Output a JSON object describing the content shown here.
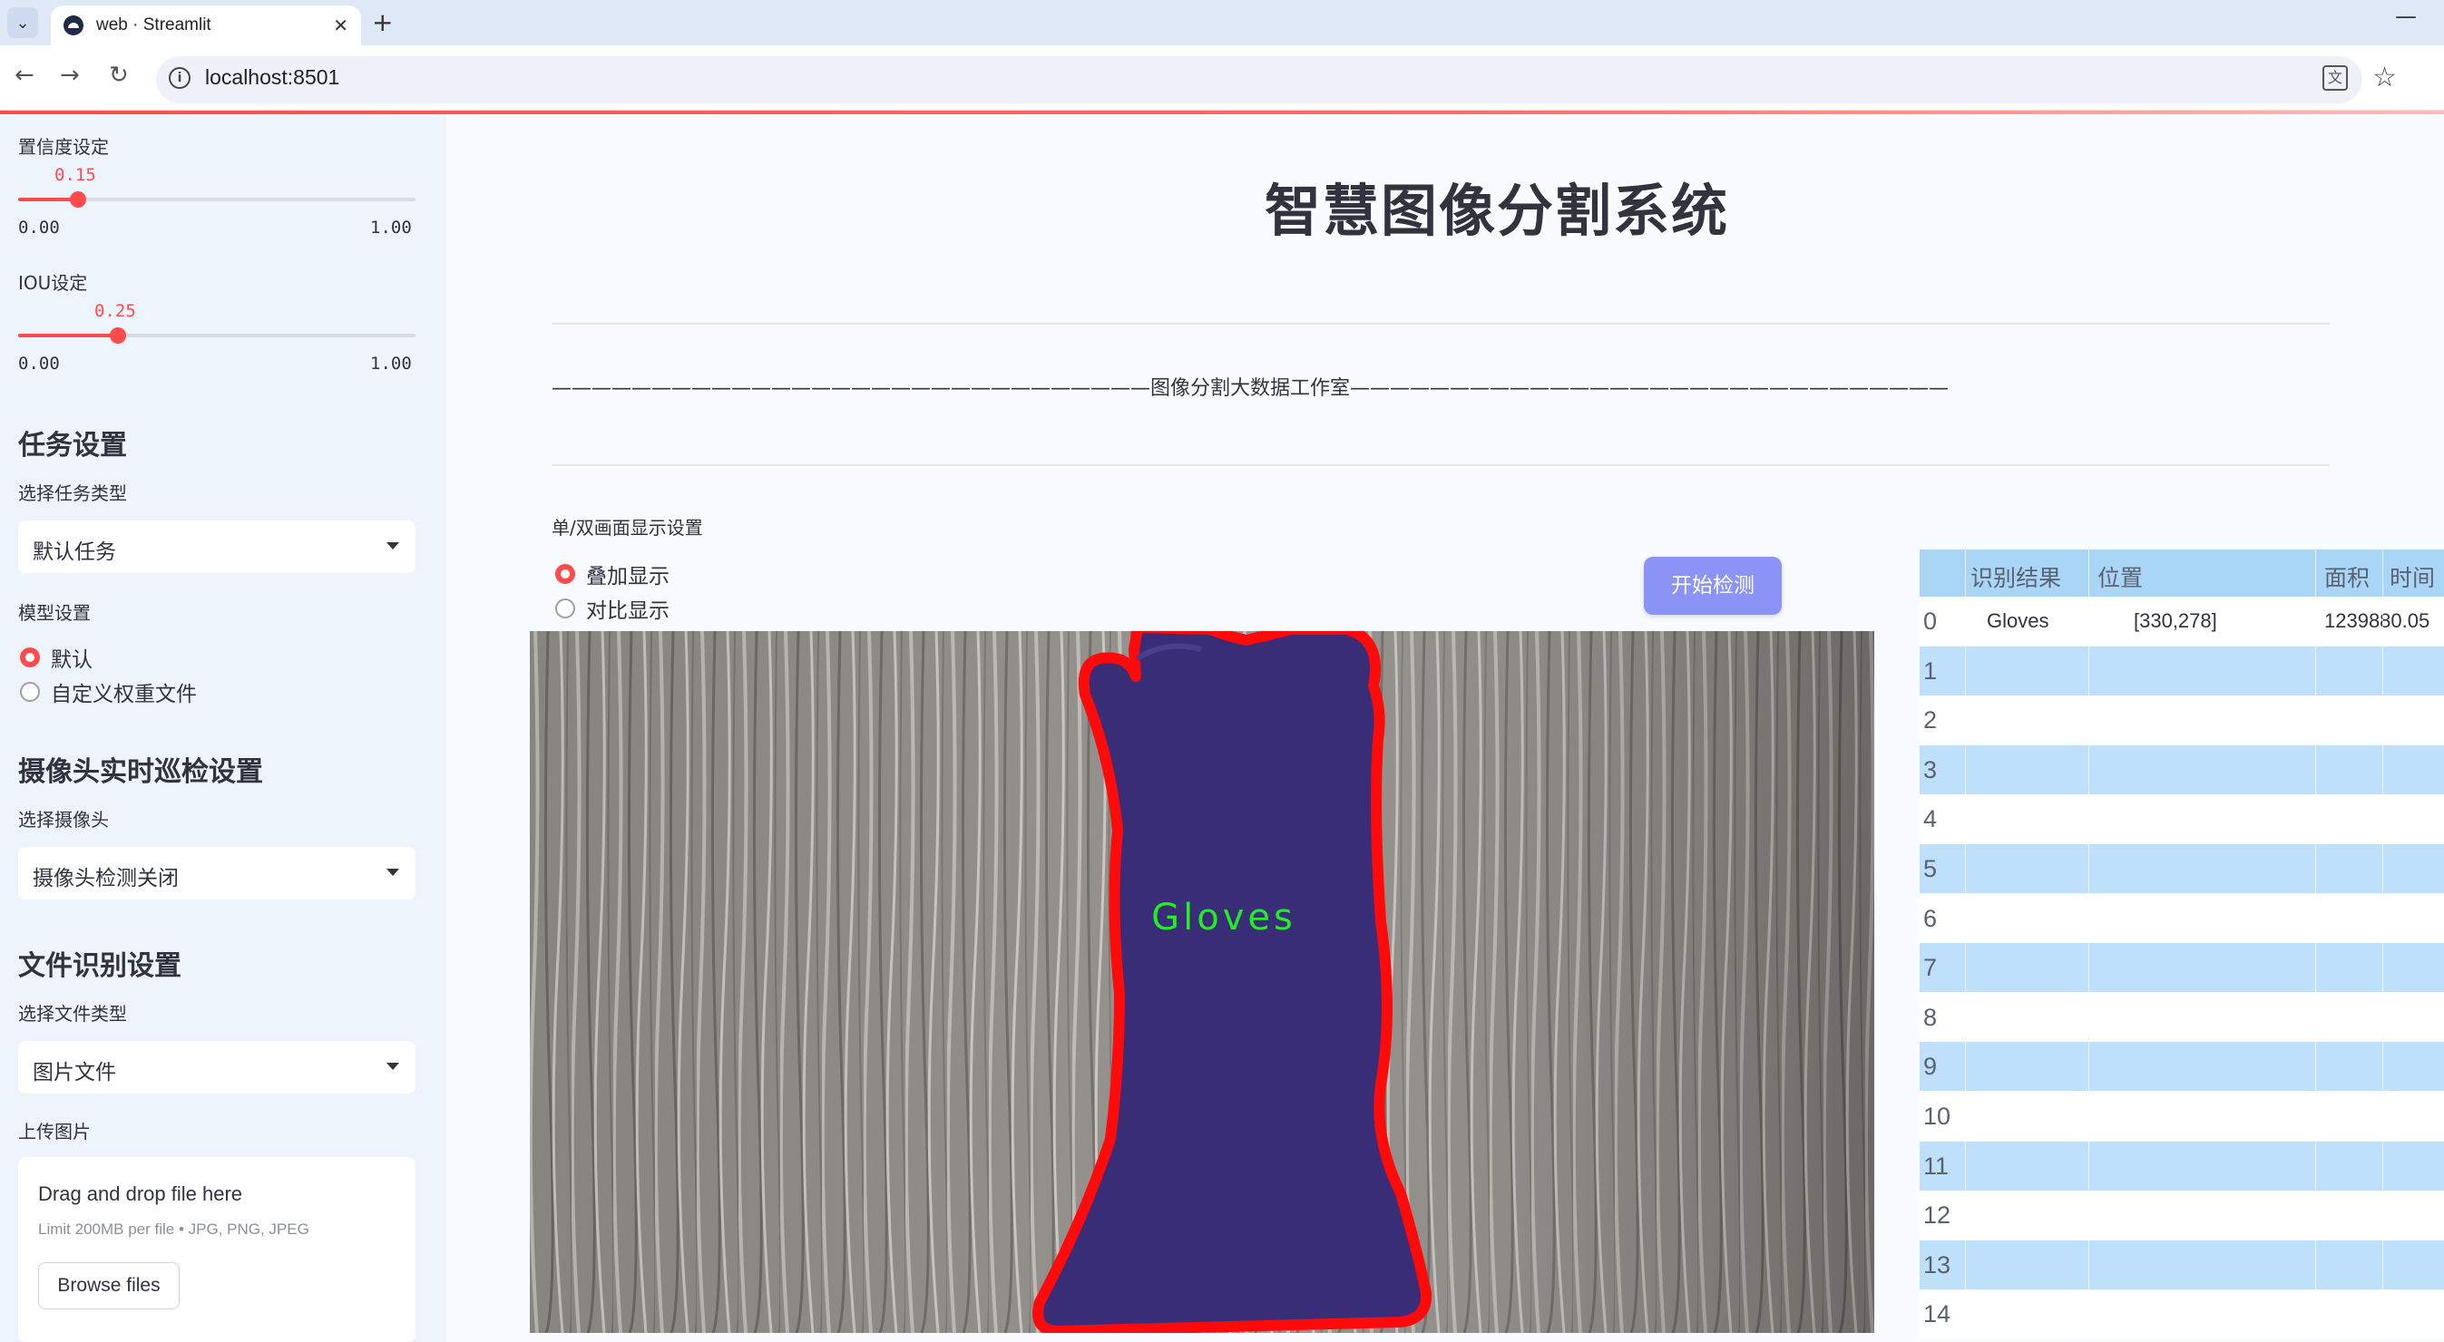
{
  "browser": {
    "tab_title": "web · Streamlit",
    "tab_close": "✕",
    "new_tab": "+",
    "minimize": "—",
    "url": "localhost:8501",
    "back": "←",
    "forward": "→",
    "reload": "↻",
    "dropdown": "⌄",
    "info": "i",
    "translate": "文",
    "bookmark": "☆"
  },
  "sidebar": {
    "confidence_label": "置信度设定",
    "confidence": {
      "value": 0.15,
      "value_text": "0.15",
      "min": "0.00",
      "max": "1.00"
    },
    "iou_label": "IOU设定",
    "iou": {
      "value": 0.25,
      "value_text": "0.25",
      "min": "0.00",
      "max": "1.00"
    },
    "task_heading": "任务设置",
    "task_type_label": "选择任务类型",
    "task_type_value": "默认任务",
    "model_label": "模型设置",
    "model_options": [
      "默认",
      "自定义权重文件"
    ],
    "model_selected": 0,
    "camera_heading": "摄像头实时巡检设置",
    "camera_label": "选择摄像头",
    "camera_value": "摄像头检测关闭",
    "file_heading": "文件识别设置",
    "file_type_label": "选择文件类型",
    "file_type_value": "图片文件",
    "upload_label": "上传图片",
    "upload_title": "Drag and drop file here",
    "upload_sub": "Limit 200MB per file • JPG, PNG, JPEG",
    "browse_button": "Browse files"
  },
  "main": {
    "title": "智慧图像分割系统",
    "studio_line": "——————————————————————————————图像分割大数据工作室——————————————————————————————",
    "display_label": "单/双画面显示设置",
    "display_options": [
      "叠加显示",
      "对比显示"
    ],
    "display_selected": 0,
    "start_button": "开始检测",
    "detection_label": "Gloves"
  },
  "colors": {
    "accent": "#ff4b4b",
    "button": "#8b93f6",
    "mask": "#3a2d78",
    "outline": "#ff0a0a",
    "label_green": "#22ee22"
  },
  "table": {
    "headers": [
      "识别结果",
      "位置",
      "面积",
      "时间"
    ],
    "rows": [
      {
        "index": "0",
        "result": "Gloves",
        "position": "[330,278]",
        "area": "1239880.05",
        "time": ""
      },
      {
        "index": "1"
      },
      {
        "index": "2"
      },
      {
        "index": "3"
      },
      {
        "index": "4"
      },
      {
        "index": "5"
      },
      {
        "index": "6"
      },
      {
        "index": "7"
      },
      {
        "index": "8"
      },
      {
        "index": "9"
      },
      {
        "index": "10"
      },
      {
        "index": "11"
      },
      {
        "index": "12"
      },
      {
        "index": "13"
      },
      {
        "index": "14"
      }
    ]
  }
}
